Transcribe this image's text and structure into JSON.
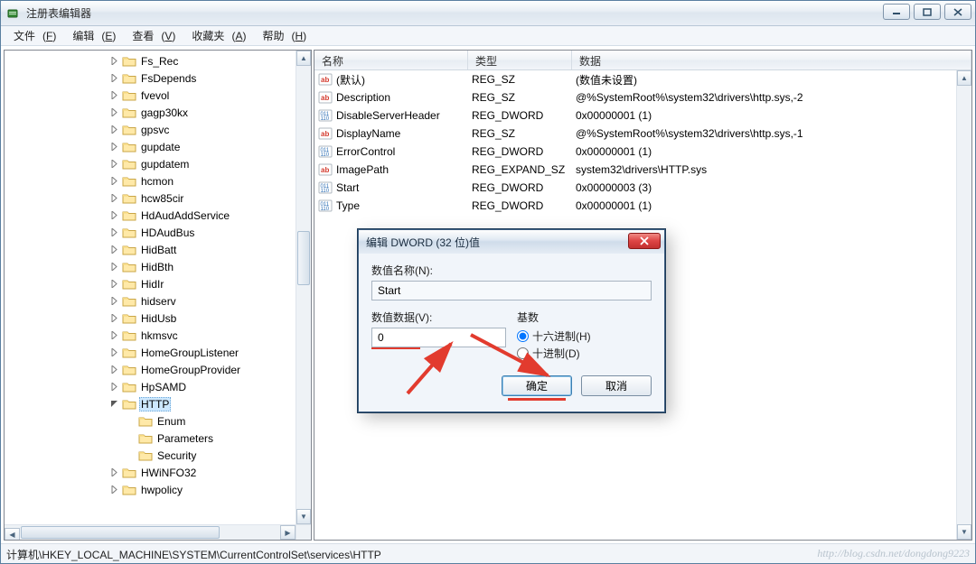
{
  "window": {
    "title": "注册表编辑器"
  },
  "menu": {
    "file": "文件",
    "file_u": "F",
    "edit": "编辑",
    "edit_u": "E",
    "view": "查看",
    "view_u": "V",
    "fav": "收藏夹",
    "fav_u": "A",
    "help": "帮助",
    "help_u": "H"
  },
  "tree": {
    "items": [
      {
        "d": 6,
        "e": "c",
        "n": "Fs_Rec"
      },
      {
        "d": 6,
        "e": "c",
        "n": "FsDepends"
      },
      {
        "d": 6,
        "e": "c",
        "n": "fvevol"
      },
      {
        "d": 6,
        "e": "c",
        "n": "gagp30kx"
      },
      {
        "d": 6,
        "e": "c",
        "n": "gpsvc"
      },
      {
        "d": 6,
        "e": "c",
        "n": "gupdate"
      },
      {
        "d": 6,
        "e": "c",
        "n": "gupdatem"
      },
      {
        "d": 6,
        "e": "c",
        "n": "hcmon"
      },
      {
        "d": 6,
        "e": "c",
        "n": "hcw85cir"
      },
      {
        "d": 6,
        "e": "c",
        "n": "HdAudAddService"
      },
      {
        "d": 6,
        "e": "c",
        "n": "HDAudBus"
      },
      {
        "d": 6,
        "e": "c",
        "n": "HidBatt"
      },
      {
        "d": 6,
        "e": "c",
        "n": "HidBth"
      },
      {
        "d": 6,
        "e": "c",
        "n": "HidIr"
      },
      {
        "d": 6,
        "e": "c",
        "n": "hidserv"
      },
      {
        "d": 6,
        "e": "c",
        "n": "HidUsb"
      },
      {
        "d": 6,
        "e": "c",
        "n": "hkmsvc"
      },
      {
        "d": 6,
        "e": "c",
        "n": "HomeGroupListener"
      },
      {
        "d": 6,
        "e": "c",
        "n": "HomeGroupProvider"
      },
      {
        "d": 6,
        "e": "c",
        "n": "HpSAMD"
      },
      {
        "d": 6,
        "e": "o",
        "n": "HTTP",
        "sel": true
      },
      {
        "d": 7,
        "e": "n",
        "n": "Enum"
      },
      {
        "d": 7,
        "e": "n",
        "n": "Parameters"
      },
      {
        "d": 7,
        "e": "n",
        "n": "Security"
      },
      {
        "d": 6,
        "e": "c",
        "n": "HWiNFO32"
      },
      {
        "d": 6,
        "e": "c",
        "n": "hwpolicy"
      }
    ]
  },
  "list": {
    "cols": {
      "name": "名称",
      "type": "类型",
      "data": "数据"
    },
    "rows": [
      {
        "ico": "sz",
        "name": "(默认)",
        "type": "REG_SZ",
        "data": "(数值未设置)"
      },
      {
        "ico": "sz",
        "name": "Description",
        "type": "REG_SZ",
        "data": "@%SystemRoot%\\system32\\drivers\\http.sys,-2"
      },
      {
        "ico": "dw",
        "name": "DisableServerHeader",
        "type": "REG_DWORD",
        "data": "0x00000001 (1)"
      },
      {
        "ico": "sz",
        "name": "DisplayName",
        "type": "REG_SZ",
        "data": "@%SystemRoot%\\system32\\drivers\\http.sys,-1"
      },
      {
        "ico": "dw",
        "name": "ErrorControl",
        "type": "REG_DWORD",
        "data": "0x00000001 (1)"
      },
      {
        "ico": "sz",
        "name": "ImagePath",
        "type": "REG_EXPAND_SZ",
        "data": "system32\\drivers\\HTTP.sys"
      },
      {
        "ico": "dw",
        "name": "Start",
        "type": "REG_DWORD",
        "data": "0x00000003 (3)"
      },
      {
        "ico": "dw",
        "name": "Type",
        "type": "REG_DWORD",
        "data": "0x00000001 (1)"
      }
    ]
  },
  "statusbar": {
    "path": "计算机\\HKEY_LOCAL_MACHINE\\SYSTEM\\CurrentControlSet\\services\\HTTP",
    "watermark": "http://blog.csdn.net/dongdong9223"
  },
  "dialog": {
    "title": "编辑 DWORD (32 位)值",
    "name_label": "数值名称(N):",
    "name_value": "Start",
    "data_label": "数值数据(V):",
    "data_value": "0",
    "base_label": "基数",
    "hex_label": "十六进制(H)",
    "dec_label": "十进制(D)",
    "ok": "确定",
    "cancel": "取消"
  }
}
